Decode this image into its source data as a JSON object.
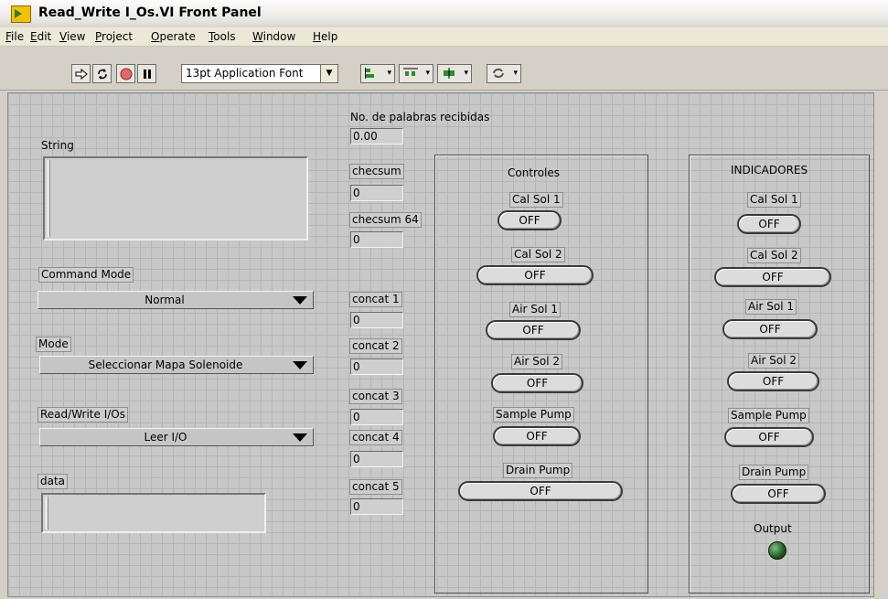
{
  "window": {
    "title": "Read_Write I_Os.VI Front Panel"
  },
  "menu": {
    "items": [
      "File",
      "Edit",
      "View",
      "Project",
      "Operate",
      "Tools",
      "Window",
      "Help"
    ]
  },
  "toolbar": {
    "font_label": "13pt Application Font"
  },
  "left": {
    "string_label": "String",
    "command_mode_label": "Command Mode",
    "command_mode_value": "Normal",
    "mode_label": "Mode",
    "mode_value": "Seleccionar Mapa Solenoide",
    "rw_label": "Read/Write I/Os",
    "rw_value": "Leer I/O",
    "data_label": "data"
  },
  "middle": {
    "words_label": "No. de palabras recibidas",
    "words_value": "0.00",
    "checksum_label": "checsum",
    "checksum_value": "0",
    "checksum64_label": "checsum 64",
    "checksum64_value": "0",
    "concat": [
      {
        "label": "concat 1",
        "value": "0"
      },
      {
        "label": "concat 2",
        "value": "0"
      },
      {
        "label": "concat 3",
        "value": "0"
      },
      {
        "label": "concat 4",
        "value": "0"
      },
      {
        "label": "concat 5",
        "value": "0"
      }
    ]
  },
  "controles": {
    "title": "Controles",
    "items": [
      {
        "label": "Cal Sol 1",
        "state": "OFF"
      },
      {
        "label": "Cal Sol 2",
        "state": "OFF"
      },
      {
        "label": "Air Sol 1",
        "state": "OFF"
      },
      {
        "label": "Air Sol 2",
        "state": "OFF"
      },
      {
        "label": "Sample Pump",
        "state": "OFF"
      },
      {
        "label": "Drain Pump",
        "state": "OFF"
      }
    ]
  },
  "indicadores": {
    "title": "INDICADORES",
    "items": [
      {
        "label": "Cal Sol 1",
        "state": "OFF"
      },
      {
        "label": "Cal Sol 2",
        "state": "OFF"
      },
      {
        "label": "Air Sol 1",
        "state": "OFF"
      },
      {
        "label": "Air Sol 2",
        "state": "OFF"
      },
      {
        "label": "Sample Pump",
        "state": "OFF"
      },
      {
        "label": "Drain Pump",
        "state": "OFF"
      }
    ],
    "output_label": "Output",
    "led_color": "#1e5a1e"
  }
}
